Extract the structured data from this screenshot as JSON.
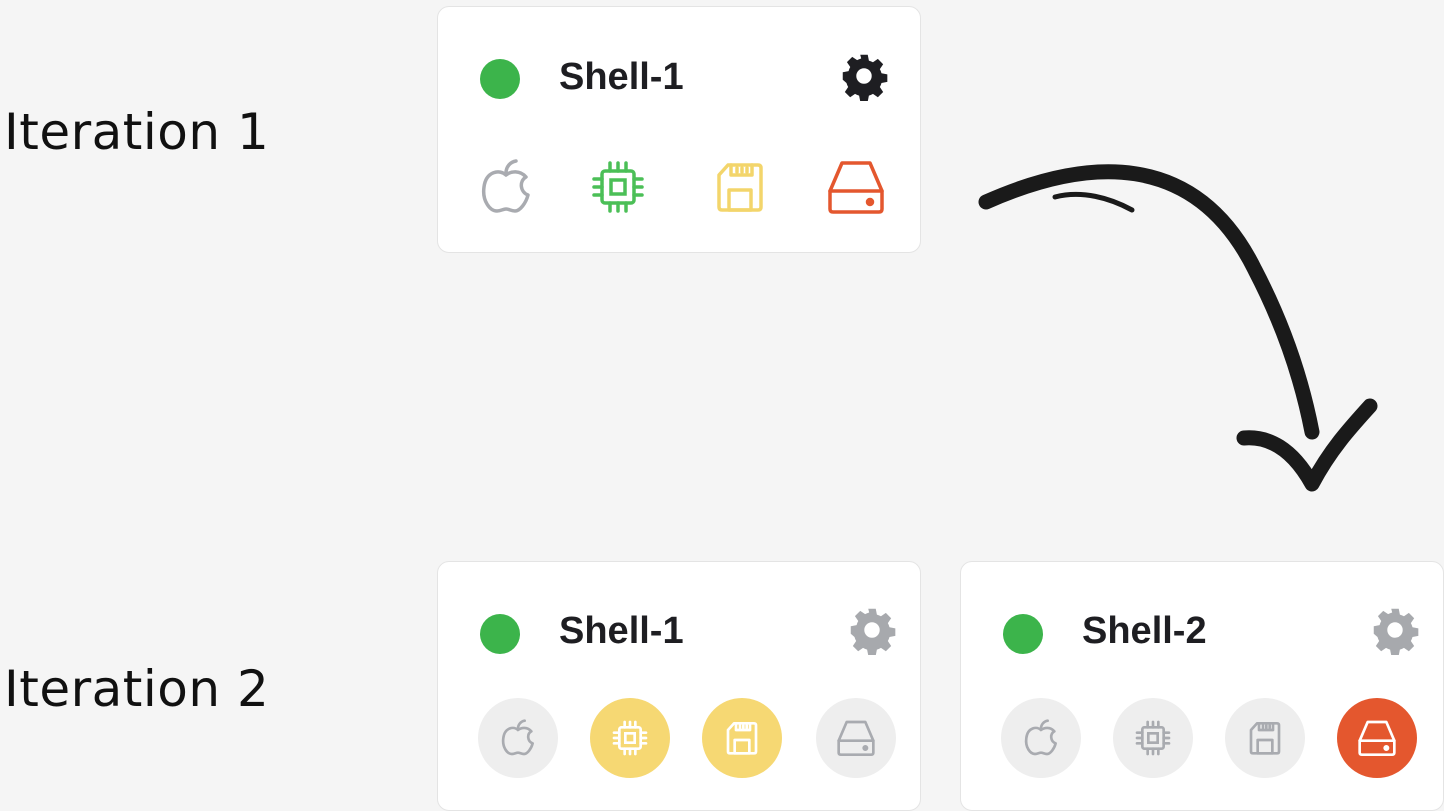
{
  "labels": {
    "iteration_1": "Iteration 1",
    "iteration_2": "Iteration 2"
  },
  "cards": {
    "it1_shell1": {
      "name": "Shell-1",
      "status": "online",
      "settings_icon": "gear-icon"
    },
    "it2_shell1": {
      "name": "Shell-1",
      "status": "online",
      "settings_icon": "gear-icon"
    },
    "it2_shell2": {
      "name": "Shell-2",
      "status": "online",
      "settings_icon": "gear-icon"
    }
  },
  "resource_icons": [
    "apple-icon",
    "cpu-chip-icon",
    "sd-card-icon",
    "hard-drive-icon"
  ],
  "colors": {
    "background": "#f5f5f5",
    "status_green": "#3cb44b",
    "cpu_green": "#4bbf57",
    "memory_yellow": "#f3d56b",
    "active_yellow": "#f6d873",
    "disk_orange": "#e4572e",
    "muted_gray": "#a9abb0",
    "muted_circle": "#eeeeee",
    "gear_dark": "#1e1e22",
    "gear_gray": "#a7a9ad",
    "arrow": "#1a1a1a"
  }
}
